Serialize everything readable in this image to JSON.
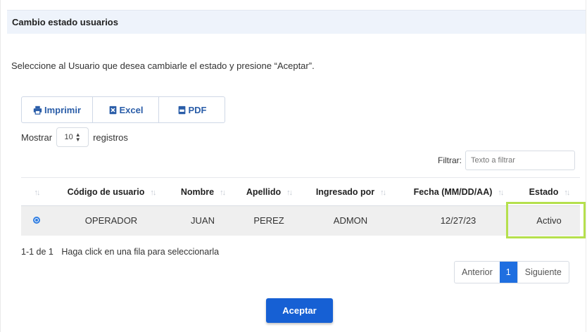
{
  "panel": {
    "title": "Cambio estado usuarios",
    "instructions": "Seleccione al Usuario que desea cambiarle el estado y presione “Aceptar”."
  },
  "export_buttons": {
    "print_label": "Imprimir",
    "excel_label": "Excel",
    "pdf_label": "PDF",
    "print_icon": "printer-icon",
    "excel_icon": "excel-file-icon",
    "pdf_icon": "pdf-file-icon"
  },
  "length_menu": {
    "prefix": "Mostrar",
    "value": "10",
    "suffix": "registros"
  },
  "filter": {
    "label": "Filtrar:",
    "placeholder": "Texto a filtrar"
  },
  "table": {
    "columns": [
      "",
      "Código de usuario",
      "Nombre",
      "Apellido",
      "Ingresado por",
      "Fecha (MM/DD/AA)",
      "Estado"
    ],
    "rows": [
      {
        "selected": true,
        "codigo": "OPERADOR",
        "nombre": "JUAN",
        "apellido": "PEREZ",
        "ingresado_por": "ADMON",
        "fecha": "12/27/23",
        "estado": "Activo"
      }
    ]
  },
  "info": {
    "range": "1-1 de 1",
    "hint": "Haga click en una fila para seleccionarla"
  },
  "pagination": {
    "previous": "Anterior",
    "current": "1",
    "next": "Siguiente"
  },
  "actions": {
    "accept_label": "Aceptar"
  },
  "colors": {
    "accent": "#1660d4",
    "highlight": "#b5e04d",
    "header_bg": "#eef3fb"
  }
}
